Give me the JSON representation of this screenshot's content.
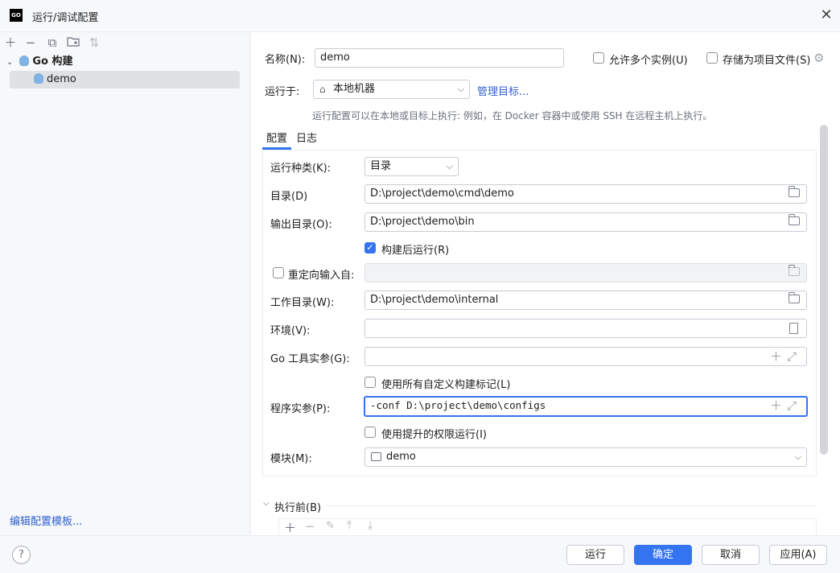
{
  "window": {
    "icon_text": "GO",
    "title": "运行/调试配置",
    "close_icon": "close-icon"
  },
  "sidebar": {
    "toolbar_icons": [
      "add-icon",
      "remove-icon",
      "copy-icon",
      "new-folder-icon",
      "sort-icon"
    ],
    "tree": {
      "group_label": "Go 构建",
      "items": [
        {
          "label": "demo",
          "selected": true
        }
      ]
    },
    "edit_templates_label": "编辑配置模板..."
  },
  "header": {
    "name_label": "名称(N):",
    "name_value": "demo",
    "allow_multiple_label": "允许多个实例(U)",
    "allow_multiple_checked": false,
    "store_as_project_label": "存储为项目文件(S)",
    "store_as_project_checked": false,
    "run_on_label": "运行于:",
    "run_on_value": "本地机器",
    "manage_targets_label": "管理目标...",
    "hint": "运行配置可以在本地或目标上执行: 例如，在 Docker 容器中或使用 SSH 在远程主机上执行。"
  },
  "tabs": [
    {
      "label": "配置",
      "active": true
    },
    {
      "label": "日志",
      "active": false
    }
  ],
  "form": {
    "run_kind_label": "运行种类(K):",
    "run_kind_value": "目录",
    "directory_label": "目录(D)",
    "directory_value": "D:\\project\\demo\\cmd\\demo",
    "output_dir_label": "输出目录(O):",
    "output_dir_value": "D:\\project\\demo\\bin",
    "run_after_build_label": "构建后运行(R)",
    "run_after_build_checked": true,
    "redirect_input_label": "重定向输入自:",
    "redirect_input_checked": false,
    "redirect_input_value": "",
    "working_dir_label": "工作目录(W):",
    "working_dir_value": "D:\\project\\demo\\internal",
    "env_label": "环境(V):",
    "env_value": "",
    "go_tool_args_label": "Go 工具实参(G):",
    "go_tool_args_value": "",
    "use_custom_tags_label": "使用所有自定义构建标记(L)",
    "use_custom_tags_checked": false,
    "program_args_label": "程序实参(P):",
    "program_args_value": "-conf D:\\project\\demo\\configs",
    "use_elevated_label": "使用提升的权限运行(I)",
    "use_elevated_checked": false,
    "module_label": "模块(M):",
    "module_value": "demo"
  },
  "before_launch": {
    "label": "执行前(B)",
    "toolbar_icons": [
      "add-icon",
      "remove-icon",
      "edit-icon",
      "move-up-icon",
      "move-down-icon"
    ]
  },
  "footer": {
    "help_label": "?",
    "run_label": "运行",
    "ok_label": "确定",
    "cancel_label": "取消",
    "apply_label": "应用(A)"
  },
  "colors": {
    "accent": "#3574f0",
    "link": "#2f5fcf",
    "background": "#f7f8fa"
  }
}
